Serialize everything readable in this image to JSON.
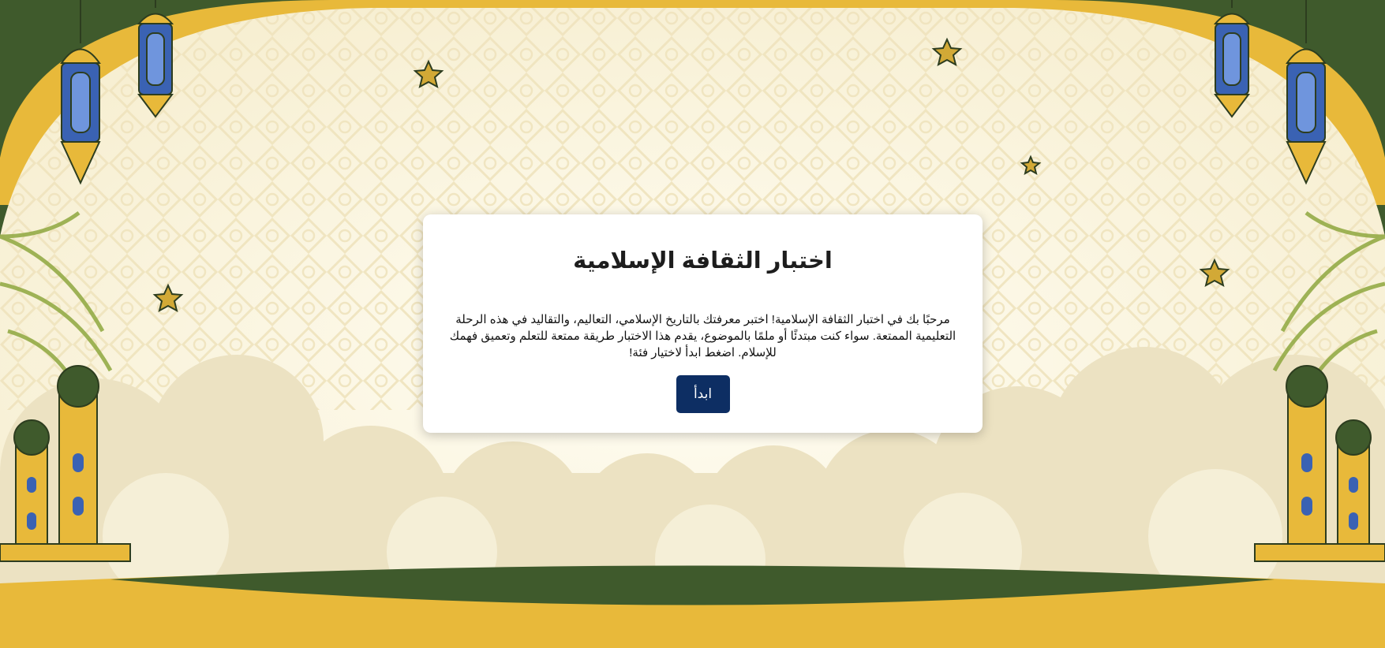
{
  "quiz": {
    "title": "اختبار الثقافة الإسلامية",
    "description": "مرحبًا بك في اختبار الثقافة الإسلامية! اختبر معرفتك بالتاريخ الإسلامي، التعاليم، والتقاليد في هذه الرحلة التعليمية الممتعة. سواء كنت مبتدئًا أو ملمًا بالموضوع، يقدم هذا الاختبار طريقة ممتعة للتعلم وتعميق فهمك للإسلام. اضغط ابدأ لاختيار فئة!",
    "start_label": "ابدأ"
  },
  "background": {
    "theme": "ramadan-arch-with-lanterns-mosques-clouds",
    "colors": {
      "cream": "#fbf6e4",
      "gold": "#e8b93a",
      "dark_green": "#3f5a2c",
      "navy_button": "#0d2e63"
    }
  }
}
